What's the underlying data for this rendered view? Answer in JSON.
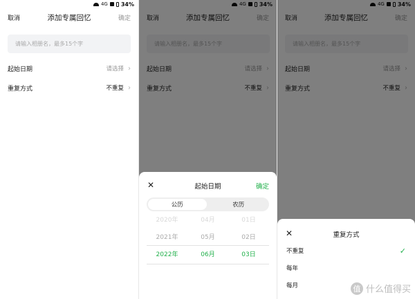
{
  "status_bar": {
    "battery": "34%",
    "network": "4G"
  },
  "header": {
    "cancel": "取消",
    "title": "添加专属回忆",
    "confirm": "确定"
  },
  "album_input": {
    "placeholder": "请输入相册名，最多15个字"
  },
  "start_date": {
    "label": "起始日期",
    "value": "请选择"
  },
  "repeat": {
    "label": "重复方式",
    "value": "不重复"
  },
  "date_sheet": {
    "title": "起始日期",
    "confirm": "确定",
    "tabs": [
      "公历",
      "农历"
    ],
    "active_tab": "公历",
    "rows": [
      {
        "year": "2020年",
        "month": "04月",
        "day": "01日"
      },
      {
        "year": "2021年",
        "month": "05月",
        "day": "02日"
      },
      {
        "year": "2022年",
        "month": "06月",
        "day": "03日"
      }
    ],
    "selected_index": 2
  },
  "repeat_sheet": {
    "title": "重复方式",
    "options": [
      "不重复",
      "每年",
      "每月"
    ],
    "selected": "不重复"
  },
  "watermark": {
    "text": "什么值得买",
    "badge": "值"
  },
  "colors": {
    "accent": "#21b04b",
    "overlay": "rgba(0,0,0,0.5)"
  }
}
